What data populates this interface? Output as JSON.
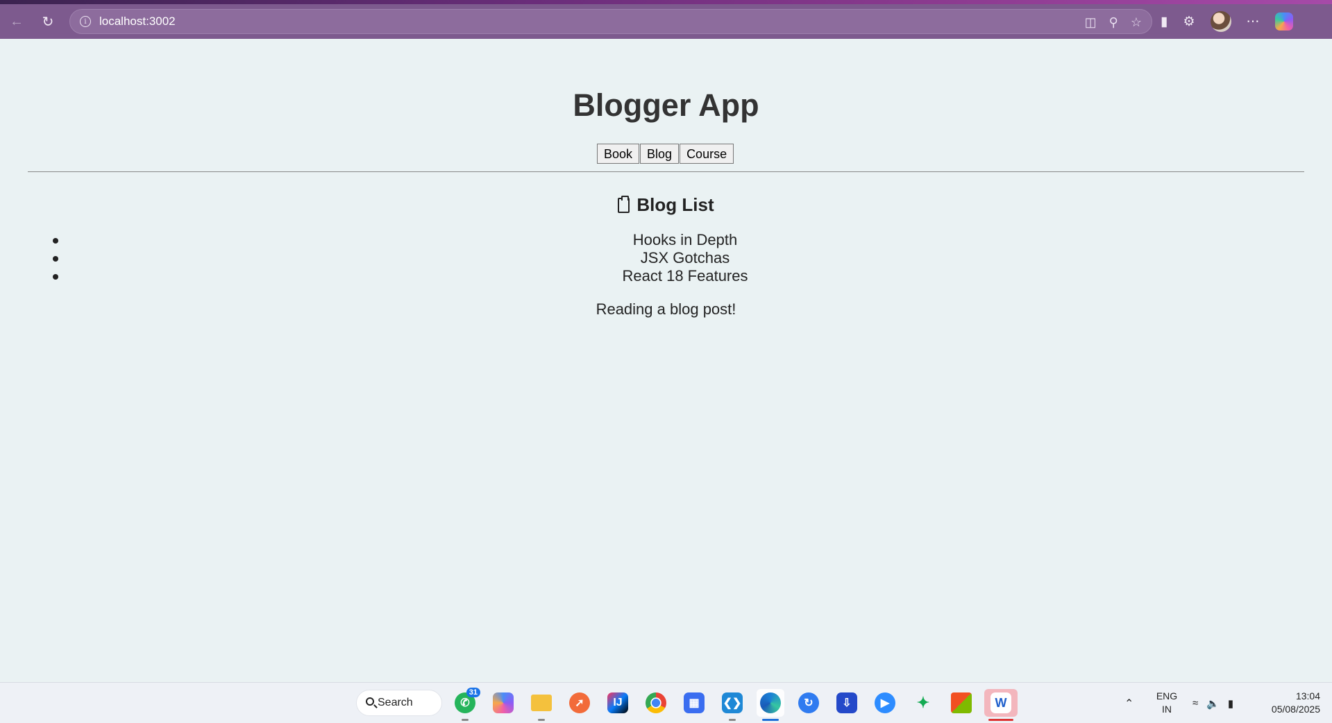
{
  "browser": {
    "url": "localhost:3002",
    "back_icon": "back-arrow-icon",
    "reload_icon": "reload-icon"
  },
  "page": {
    "title": "Blogger App",
    "nav_buttons": [
      "Book",
      "Blog",
      "Course"
    ],
    "section_title": "Blog List",
    "blog_items": [
      "Hooks in Depth",
      "JSX Gotchas",
      "React 18 Features"
    ],
    "reading_text": "Reading a blog post!"
  },
  "taskbar": {
    "search_label": "Search",
    "whatsapp_badge": "31",
    "language_line1": "ENG",
    "language_line2": "IN",
    "time": "13:04",
    "date": "05/08/2025"
  },
  "colors": {
    "browser_toolbar": "#7d5a8e",
    "page_background": "#eaf2f3",
    "taskbar": "#eef1f6"
  }
}
